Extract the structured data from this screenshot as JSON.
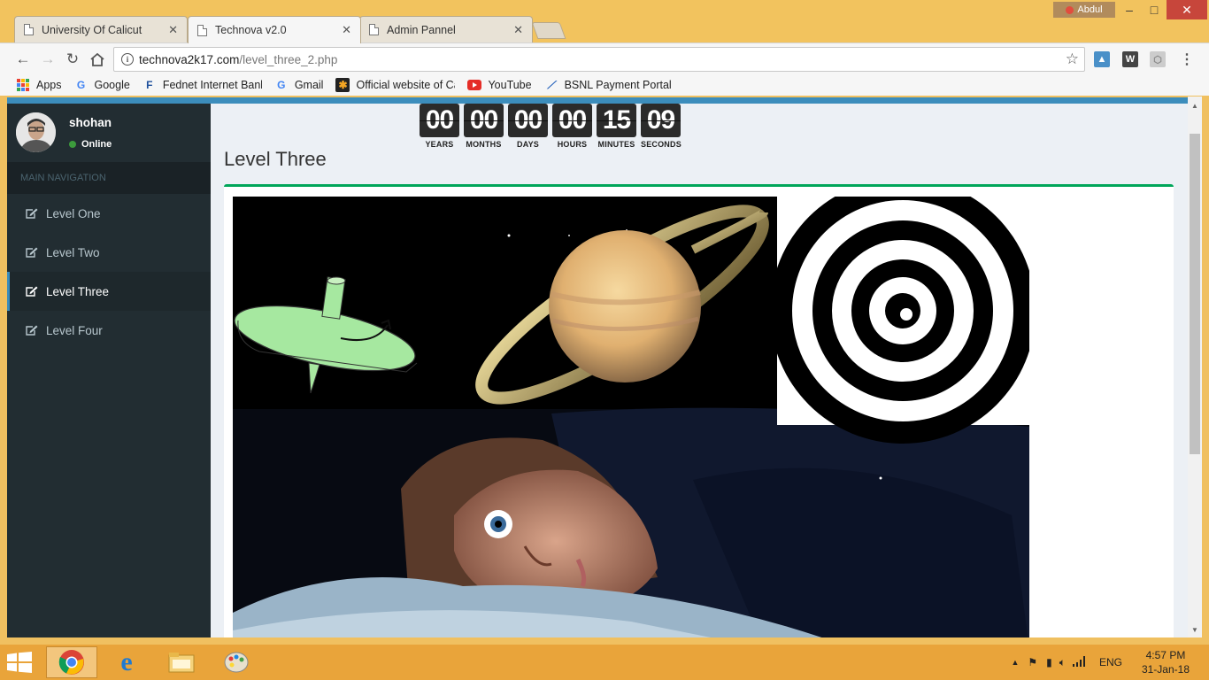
{
  "browser": {
    "tabs": [
      {
        "title": "University Of Calicut",
        "active": false
      },
      {
        "title": "Technova v2.0",
        "active": true
      },
      {
        "title": "Admin Pannel",
        "active": false
      }
    ],
    "profile_name": "Abdul",
    "url_host": "technova2k17.com",
    "url_path": "/level_three_2.php",
    "bookmarks": [
      {
        "label": "Apps",
        "icon": "apps-grid-icon"
      },
      {
        "label": "Google",
        "icon": "google-icon"
      },
      {
        "label": "Fednet Internet Bank",
        "icon": "federal-bank-icon"
      },
      {
        "label": "Gmail",
        "icon": "google-icon"
      },
      {
        "label": "Official website of Ca",
        "icon": "joomla-icon"
      },
      {
        "label": "YouTube",
        "icon": "youtube-icon"
      },
      {
        "label": "BSNL Payment Portal",
        "icon": "bsnl-icon"
      }
    ]
  },
  "sidebar": {
    "user_name": "shohan",
    "status": "Online",
    "header": "MAIN NAVIGATION",
    "items": [
      {
        "label": "Level One",
        "active": false
      },
      {
        "label": "Level Two",
        "active": false
      },
      {
        "label": "Level Three",
        "active": true
      },
      {
        "label": "Level Four",
        "active": false
      }
    ]
  },
  "countdown": [
    {
      "value": "00",
      "label": "YEARS"
    },
    {
      "value": "00",
      "label": "MONTHS"
    },
    {
      "value": "00",
      "label": "DAYS"
    },
    {
      "value": "00",
      "label": "HOURS"
    },
    {
      "value": "15",
      "label": "MINUTES"
    },
    {
      "value": "09",
      "label": "SECONDS"
    }
  ],
  "main": {
    "title": "Level Three"
  },
  "taskbar": {
    "language": "ENG",
    "time": "4:57 PM",
    "date": "31-Jan-18"
  },
  "colors": {
    "sidebar_bg": "#222d32",
    "accent_blue": "#3c8dbc",
    "box_border_green": "#00a65a",
    "taskbar": "#e9a43a"
  }
}
